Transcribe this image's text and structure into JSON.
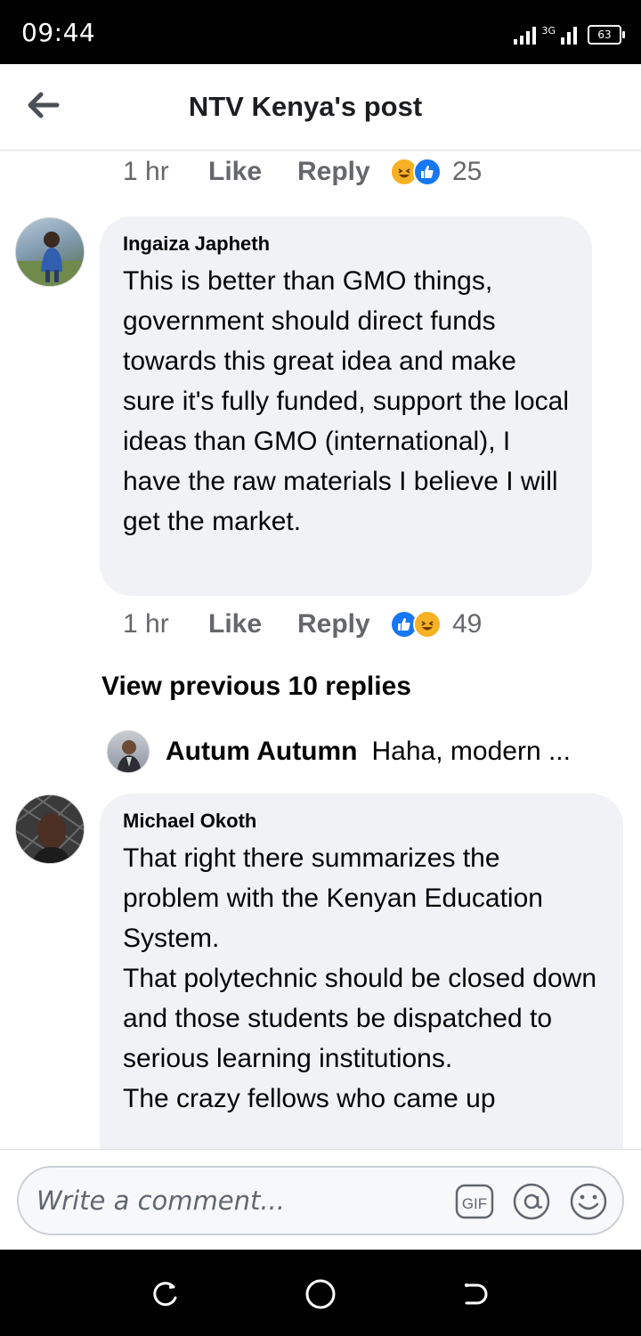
{
  "status_bar": {
    "time": "09:44",
    "network": "3G",
    "battery": "63"
  },
  "header": {
    "title": "NTV Kenya's post"
  },
  "comments": [
    {
      "meta": {
        "time": "1 hr",
        "like": "Like",
        "reply": "Reply",
        "count": "25",
        "reactions": [
          "haha",
          "like"
        ]
      }
    },
    {
      "author": "Ingaiza Japheth",
      "text": "This is better than GMO things, government should direct funds towards this great idea and make sure it's fully funded, support the local ideas than GMO (international), I have the raw materials I believe I will get the market.",
      "meta": {
        "time": "1 hr",
        "like": "Like",
        "reply": "Reply",
        "count": "49",
        "reactions": [
          "like",
          "haha"
        ]
      }
    },
    {
      "author": "Michael Okoth",
      "text": "That right there summarizes the problem with the Kenyan Education System.\nThat polytechnic should be closed down and those students be dispatched to serious learning institutions.\nThe crazy fellows who came up"
    }
  ],
  "replies": {
    "view_previous": "View previous 10 replies",
    "latest": {
      "author": "Autum Autumn",
      "text": "Haha, modern ..."
    }
  },
  "composer": {
    "placeholder": "Write a comment...",
    "gif_label": "GIF"
  },
  "colors": {
    "accent": "#1877f2",
    "bubble": "#f0f2f5",
    "secondary_text": "#65676b"
  }
}
